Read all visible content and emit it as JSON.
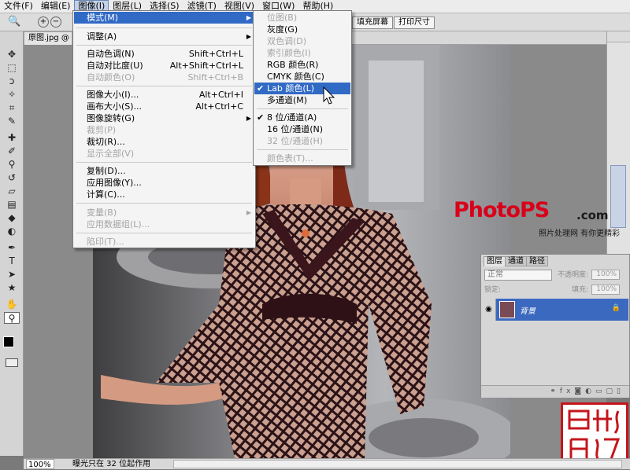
{
  "menubar": {
    "items": [
      "文件(F)",
      "编辑(E)",
      "图像(I)",
      "图层(L)",
      "选择(S)",
      "滤镜(T)",
      "视图(V)",
      "窗口(W)",
      "帮助(H)"
    ]
  },
  "options_bar": {
    "fill_screen": "填充屏幕",
    "print_size": "打印尺寸"
  },
  "document": {
    "tab_title": "原图.jpg @ 1",
    "zoom": "100%",
    "status_text": "曝光只在 32 位起作用"
  },
  "image_menu": {
    "items": [
      {
        "label": "模式(M)",
        "submenu": true,
        "highlighted": true
      },
      {
        "label": "调整(A)",
        "submenu": true
      },
      {
        "label": "自动色调(N)",
        "shortcut": "Shift+Ctrl+L"
      },
      {
        "label": "自动对比度(U)",
        "shortcut": "Alt+Shift+Ctrl+L"
      },
      {
        "label": "自动颜色(O)",
        "shortcut": "Shift+Ctrl+B",
        "disabled": true
      },
      {
        "label": "图像大小(I)...",
        "shortcut": "Alt+Ctrl+I"
      },
      {
        "label": "画布大小(S)...",
        "shortcut": "Alt+Ctrl+C"
      },
      {
        "label": "图像旋转(G)",
        "submenu": true
      },
      {
        "label": "裁剪(P)",
        "disabled": true
      },
      {
        "label": "裁切(R)..."
      },
      {
        "label": "显示全部(V)",
        "disabled": true
      },
      {
        "label": "复制(D)..."
      },
      {
        "label": "应用图像(Y)..."
      },
      {
        "label": "计算(C)..."
      },
      {
        "label": "变量(B)",
        "submenu": true,
        "disabled": true
      },
      {
        "label": "应用数据组(L)...",
        "disabled": true
      },
      {
        "label": "陷印(T)...",
        "disabled": true
      }
    ]
  },
  "mode_submenu": {
    "items": [
      {
        "label": "位图(B)",
        "disabled": true
      },
      {
        "label": "灰度(G)"
      },
      {
        "label": "双色调(D)",
        "disabled": true
      },
      {
        "label": "索引颜色(I)",
        "disabled": true
      },
      {
        "label": "RGB 颜色(R)"
      },
      {
        "label": "CMYK 颜色(C)"
      },
      {
        "label": "Lab 颜色(L)",
        "checked": true,
        "highlighted": true
      },
      {
        "label": "多通道(M)"
      },
      {
        "label": "8 位/通道(A)",
        "checked": true
      },
      {
        "label": "16 位/通道(N)"
      },
      {
        "label": "32 位/通道(H)",
        "disabled": true
      },
      {
        "label": "颜色表(T)...",
        "disabled": true
      }
    ]
  },
  "layers_panel": {
    "tabs": [
      "图层",
      "通道",
      "路径"
    ],
    "blend_mode": "正常",
    "opacity_label": "不透明度:",
    "opacity_value": "100%",
    "lock_label": "锁定:",
    "fill_label": "填充:",
    "fill_value": "100%",
    "layer_name": "背景"
  },
  "watermark": {
    "brand": "PhotoPS",
    "domain": ".com",
    "slogan": "照片处理网 有你更精彩"
  },
  "colors": {
    "highlight": "#316ac5",
    "logo_red": "#d8001a",
    "seal_red": "#c4151c"
  }
}
